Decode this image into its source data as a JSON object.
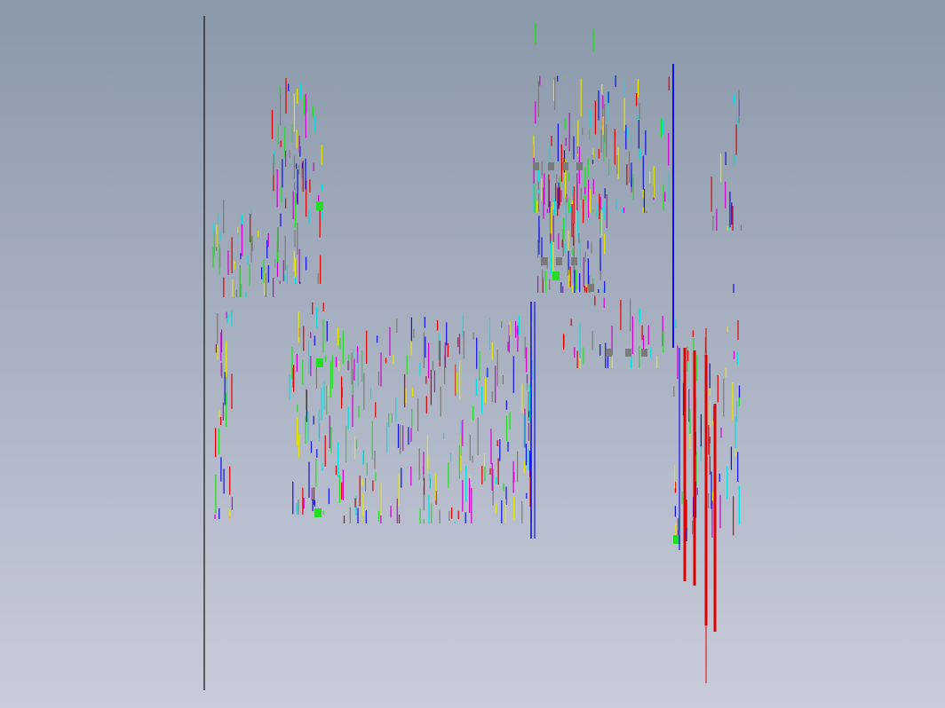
{
  "viewport": {
    "background_top": "#8a98a9",
    "background_bottom": "#c9ccda"
  },
  "palette": {
    "border": "#111111",
    "blue": "#1010e6",
    "red": "#e00000",
    "green": "#22dd22",
    "magenta": "#d000d0",
    "cyan": "#00e0e0",
    "yellow": "#e6e600",
    "gray": "#7a7a7a"
  },
  "drawing": {
    "type": "cad-wireframe",
    "description_text": ""
  }
}
